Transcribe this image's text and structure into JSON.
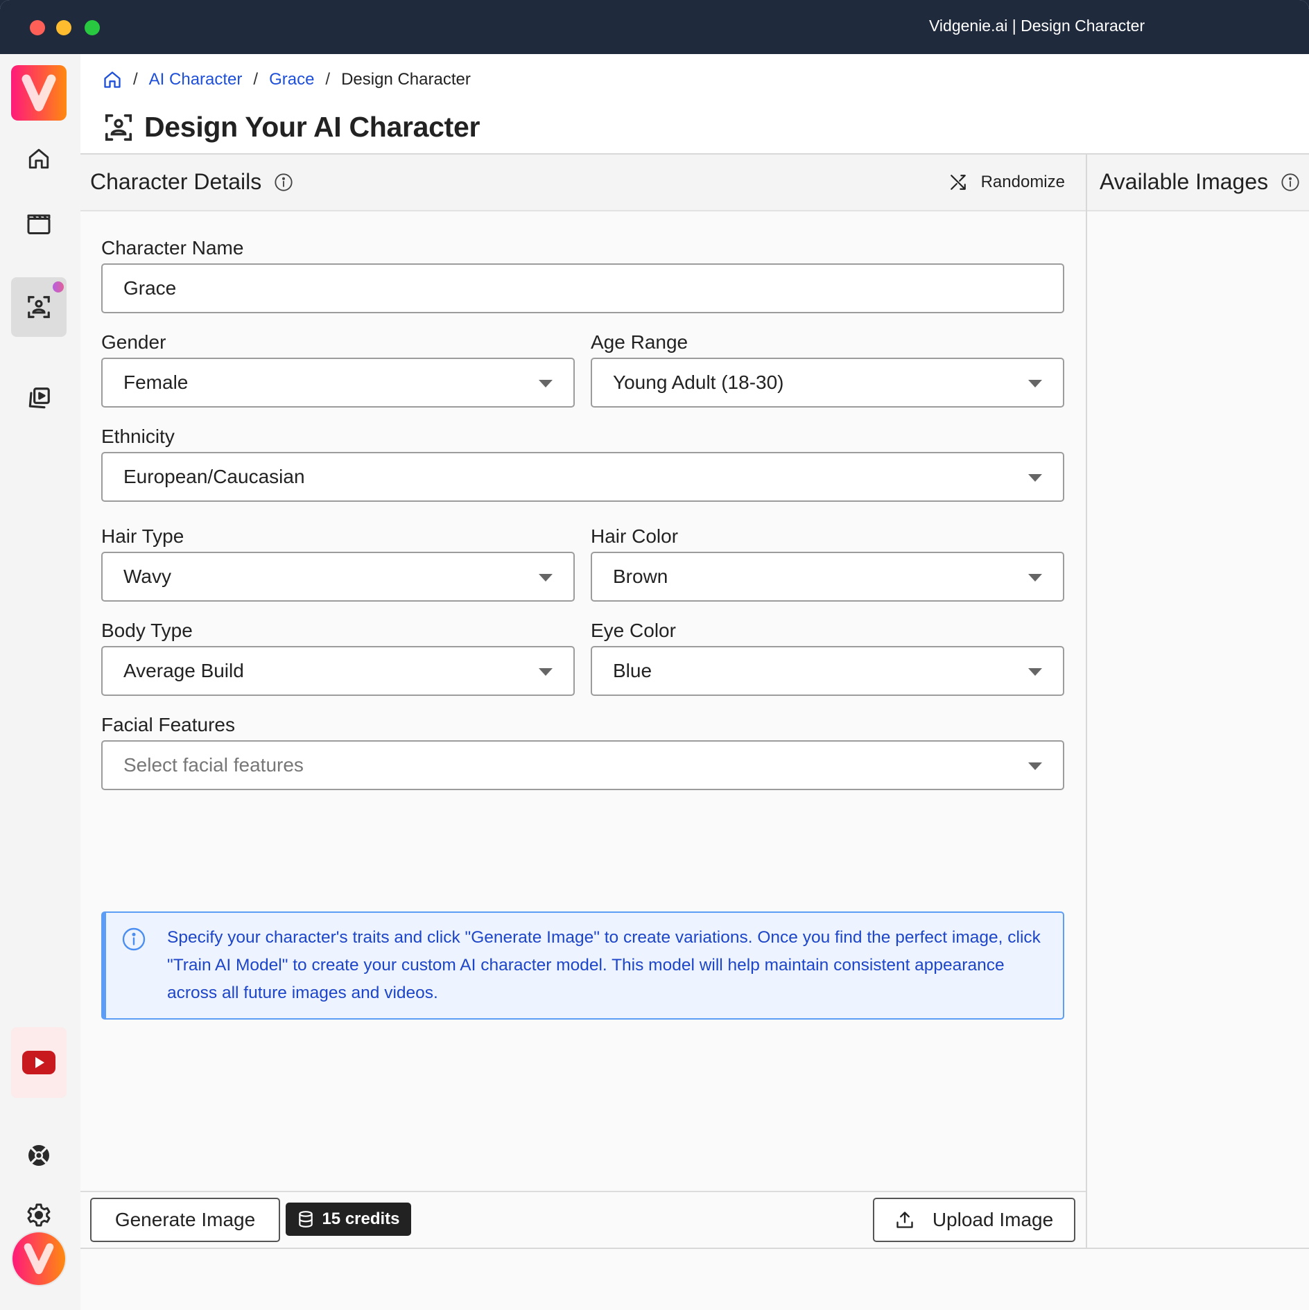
{
  "window": {
    "title": "Vidgenie.ai | Design Character"
  },
  "sidebar": {
    "items": [
      {
        "name": "home",
        "icon": "home-icon"
      },
      {
        "name": "videos",
        "icon": "clapperboard-icon"
      },
      {
        "name": "ai-character",
        "icon": "user-scan-icon",
        "active": true,
        "has_notification": true
      },
      {
        "name": "media-library",
        "icon": "play-stack-icon"
      }
    ],
    "bottom_items": [
      {
        "name": "youtube",
        "icon": "youtube-icon"
      },
      {
        "name": "help",
        "icon": "lifebuoy-icon"
      },
      {
        "name": "settings",
        "icon": "gear-icon"
      }
    ]
  },
  "breadcrumb": {
    "items": [
      {
        "label": "AI Character",
        "link": true
      },
      {
        "label": "Grace",
        "link": true
      },
      {
        "label": "Design Character",
        "link": false
      }
    ],
    "separator": "/"
  },
  "page": {
    "title": "Design Your AI Character"
  },
  "character_details": {
    "title": "Character Details",
    "randomize_label": "Randomize",
    "fields": {
      "name": {
        "label": "Character Name",
        "value": "Grace"
      },
      "gender": {
        "label": "Gender",
        "value": "Female"
      },
      "age_range": {
        "label": "Age Range",
        "value": "Young Adult (18-30)"
      },
      "ethnicity": {
        "label": "Ethnicity",
        "value": "European/Caucasian"
      },
      "hair_type": {
        "label": "Hair Type",
        "value": "Wavy"
      },
      "hair_color": {
        "label": "Hair Color",
        "value": "Brown"
      },
      "body_type": {
        "label": "Body Type",
        "value": "Average Build"
      },
      "eye_color": {
        "label": "Eye Color",
        "value": "Blue"
      },
      "facial_features": {
        "label": "Facial Features",
        "placeholder": "Select facial features"
      }
    },
    "info_message": "Specify your character's traits and click \"Generate Image\" to create variations. Once you find the perfect image, click \"Train AI Model\" to create your custom AI character model. This model will help maintain consistent appearance across all future images and videos."
  },
  "footer": {
    "generate_label": "Generate Image",
    "credits_label": "15 credits",
    "upload_label": "Upload Image"
  },
  "available_images": {
    "title": "Available Images"
  },
  "colors": {
    "titlebar": "#1f2a3c",
    "link": "#1e4fd8",
    "info_text": "#1d45c8",
    "info_border": "#5c9ef5",
    "info_bg": "#eef4ff",
    "brand_gradient_start": "#ff1a7a",
    "brand_gradient_end": "#ff8a10"
  }
}
